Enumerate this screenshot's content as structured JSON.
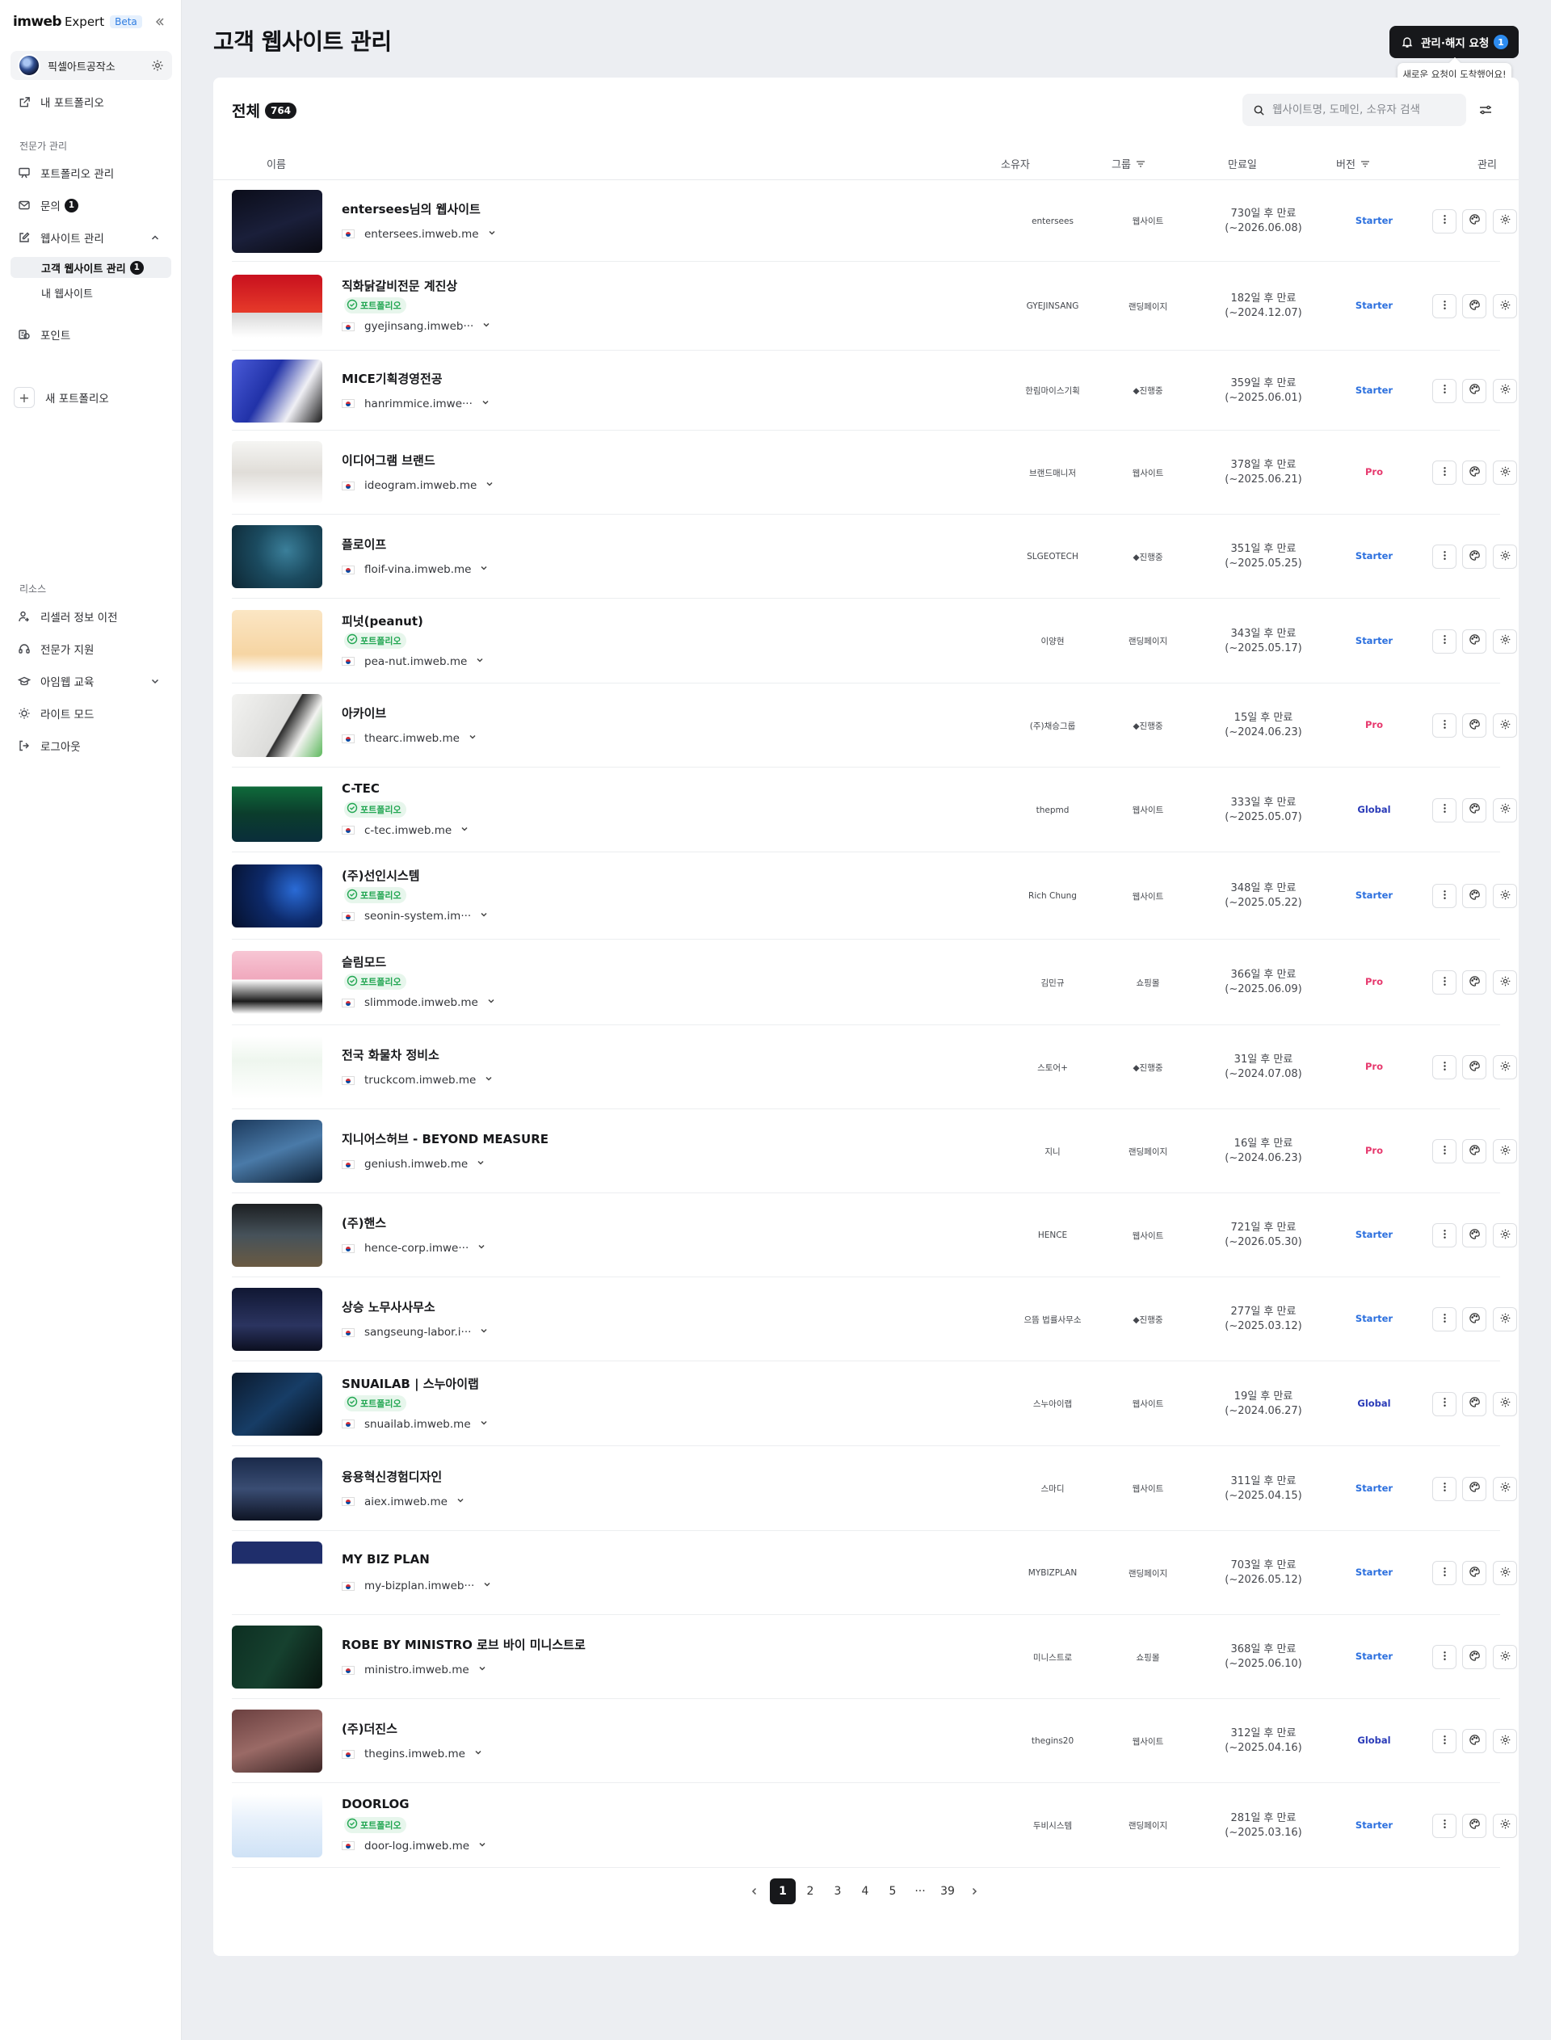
{
  "brand": {
    "logo": "imweb",
    "product": "Expert",
    "beta": "Beta"
  },
  "workspace": {
    "name": "픽셀아트공작소"
  },
  "nav": {
    "my_portfolio": "내 포트폴리오",
    "section_expert": "전문가 관리",
    "portfolio_manage": "포트폴리오 관리",
    "inquiry": "문의",
    "inquiry_count": "1",
    "website_manage": "웹사이트 관리",
    "client_sites": "고객 웹사이트 관리",
    "client_sites_count": "1",
    "my_sites": "내 웹사이트",
    "points": "포인트",
    "new_portfolio": "새 포트폴리오",
    "section_resources": "리소스",
    "reseller_transfer": "리셀러 정보 이전",
    "expert_support": "전문가 지원",
    "imweb_edu": "아임웹 교육",
    "light_mode": "라이트 모드",
    "logout": "로그아웃"
  },
  "header": {
    "title": "고객 웹사이트 관리",
    "request_button": "관리·해지 요청",
    "request_count": "1",
    "tooltip": "새로운 요청이 도착했어요!"
  },
  "table": {
    "total_label": "전체",
    "total_count": "764",
    "search_placeholder": "웹사이트명, 도메인, 소유자 검색",
    "columns": {
      "name": "이름",
      "owner": "소유자",
      "group": "그룹",
      "expiry": "만료일",
      "version": "버전",
      "manage": "관리"
    },
    "rows": [
      {
        "title": "entersees님의 웹사이트",
        "portfolio": false,
        "domain": "entersees.imweb.me",
        "owner": "entersees",
        "group": "웹사이트",
        "expire_days": "730일 후 만료",
        "expire_date": "(~2026.06.08)",
        "version": "Starter",
        "thumb": "t1"
      },
      {
        "title": "직화닭갈비전문 계진상",
        "portfolio": true,
        "domain": "gyejinsang.imweb···",
        "owner": "GYEJINSANG",
        "group": "랜딩페이지",
        "expire_days": "182일 후 만료",
        "expire_date": "(~2024.12.07)",
        "version": "Starter",
        "thumb": "t2"
      },
      {
        "title": "MICE기획경영전공",
        "portfolio": false,
        "domain": "hanrimmice.imwe···",
        "owner": "한림마이스기획",
        "group": "◆진행중",
        "expire_days": "359일 후 만료",
        "expire_date": "(~2025.06.01)",
        "version": "Starter",
        "thumb": "t3"
      },
      {
        "title": "이디어그램 브랜드",
        "portfolio": false,
        "domain": "ideogram.imweb.me",
        "owner": "브랜드매니저",
        "group": "웹사이트",
        "expire_days": "378일 후 만료",
        "expire_date": "(~2025.06.21)",
        "version": "Pro",
        "thumb": "t4"
      },
      {
        "title": "플로이프",
        "portfolio": false,
        "domain": "floif-vina.imweb.me",
        "owner": "SLGEOTECH",
        "group": "◆진행중",
        "expire_days": "351일 후 만료",
        "expire_date": "(~2025.05.25)",
        "version": "Starter",
        "thumb": "t5"
      },
      {
        "title": "피넛(peanut)",
        "portfolio": true,
        "domain": "pea-nut.imweb.me",
        "owner": "이양현",
        "group": "랜딩페이지",
        "expire_days": "343일 후 만료",
        "expire_date": "(~2025.05.17)",
        "version": "Starter",
        "thumb": "t6"
      },
      {
        "title": "아카이브",
        "portfolio": false,
        "domain": "thearc.imweb.me",
        "owner": "(주)채승그룹",
        "group": "◆진행중",
        "expire_days": "15일 후 만료",
        "expire_date": "(~2024.06.23)",
        "version": "Pro",
        "thumb": "t7"
      },
      {
        "title": "C-TEC",
        "portfolio": true,
        "domain": "c-tec.imweb.me",
        "owner": "thepmd",
        "group": "웹사이트",
        "expire_days": "333일 후 만료",
        "expire_date": "(~2025.05.07)",
        "version": "Global",
        "thumb": "t8"
      },
      {
        "title": "(주)선인시스템",
        "portfolio": true,
        "domain": "seonin-system.im···",
        "owner": "Rich Chung",
        "group": "웹사이트",
        "expire_days": "348일 후 만료",
        "expire_date": "(~2025.05.22)",
        "version": "Starter",
        "thumb": "t9"
      },
      {
        "title": "슬림모드",
        "portfolio": true,
        "domain": "slimmode.imweb.me",
        "owner": "김민규",
        "group": "쇼핑몰",
        "expire_days": "366일 후 만료",
        "expire_date": "(~2025.06.09)",
        "version": "Pro",
        "thumb": "t10"
      },
      {
        "title": "전국 화물차 정비소",
        "portfolio": false,
        "domain": "truckcom.imweb.me",
        "owner": "스토어+",
        "group": "◆진행중",
        "expire_days": "31일 후 만료",
        "expire_date": "(~2024.07.08)",
        "version": "Pro",
        "thumb": "t11"
      },
      {
        "title": "지니어스허브 - BEYOND MEASURE",
        "portfolio": false,
        "domain": "geniush.imweb.me",
        "owner": "지니",
        "group": "랜딩페이지",
        "expire_days": "16일 후 만료",
        "expire_date": "(~2024.06.23)",
        "version": "Pro",
        "thumb": "t12"
      },
      {
        "title": "(주)핸스",
        "portfolio": false,
        "domain": "hence-corp.imwe···",
        "owner": "HENCE",
        "group": "웹사이트",
        "expire_days": "721일 후 만료",
        "expire_date": "(~2026.05.30)",
        "version": "Starter",
        "thumb": "t13"
      },
      {
        "title": "상승 노무사사무소",
        "portfolio": false,
        "domain": "sangseung-labor.i···",
        "owner": "으뜸 법률사무소",
        "group": "◆진행중",
        "expire_days": "277일 후 만료",
        "expire_date": "(~2025.03.12)",
        "version": "Starter",
        "thumb": "t14"
      },
      {
        "title": "SNUAILAB | 스누아이랩",
        "portfolio": true,
        "domain": "snuailab.imweb.me",
        "owner": "스누아이랩",
        "group": "웹사이트",
        "expire_days": "19일 후 만료",
        "expire_date": "(~2024.06.27)",
        "version": "Global",
        "thumb": "t15"
      },
      {
        "title": "융용혁신경험디자인",
        "portfolio": false,
        "domain": "aiex.imweb.me",
        "owner": "스마디",
        "group": "웹사이트",
        "expire_days": "311일 후 만료",
        "expire_date": "(~2025.04.15)",
        "version": "Starter",
        "thumb": "t16"
      },
      {
        "title": "MY BIZ PLAN",
        "portfolio": false,
        "domain": "my-bizplan.imweb···",
        "owner": "MYBIZPLAN",
        "group": "랜딩페이지",
        "expire_days": "703일 후 만료",
        "expire_date": "(~2026.05.12)",
        "version": "Starter",
        "thumb": "t17"
      },
      {
        "title": "ROBE BY MINISTRO 로브 바이 미니스트로",
        "portfolio": false,
        "domain": "ministro.imweb.me",
        "owner": "미니스트로",
        "group": "쇼핑몰",
        "expire_days": "368일 후 만료",
        "expire_date": "(~2025.06.10)",
        "version": "Starter",
        "thumb": "t18"
      },
      {
        "title": "(주)더진스",
        "portfolio": false,
        "domain": "thegins.imweb.me",
        "owner": "thegins20",
        "group": "웹사이트",
        "expire_days": "312일 후 만료",
        "expire_date": "(~2025.04.16)",
        "version": "Global",
        "thumb": "t19"
      },
      {
        "title": "DOORLOG",
        "portfolio": true,
        "domain": "door-log.imweb.me",
        "owner": "두비시스템",
        "group": "랜딩페이지",
        "expire_days": "281일 후 만료",
        "expire_date": "(~2025.03.16)",
        "version": "Starter",
        "thumb": "t20"
      }
    ],
    "portfolio_badge": "포트폴리오"
  },
  "pagination": {
    "pages": [
      "1",
      "2",
      "3",
      "4",
      "5",
      "···",
      "39"
    ],
    "current": "1"
  },
  "colors": {
    "accent_dark": "#17181b",
    "link_blue": "#2b6fde",
    "pro_pink": "#e6386d",
    "global_navy": "#2a3bb8",
    "portfolio_green": "#22a652",
    "notification_blue": "#2d8cf0"
  }
}
